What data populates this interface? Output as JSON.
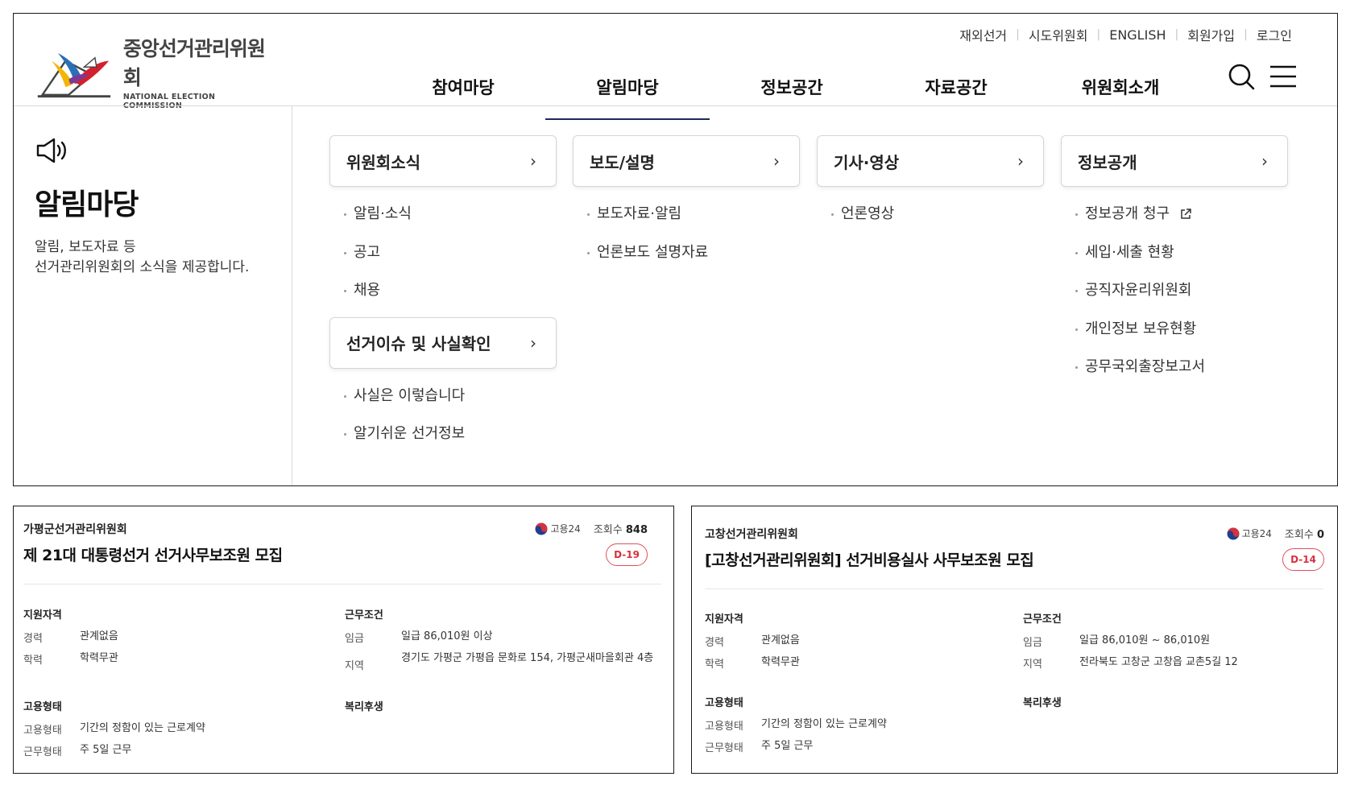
{
  "utility_nav": [
    "재외선거",
    "시도위원회",
    "ENGLISH",
    "회원가입",
    "로그인"
  ],
  "logo": {
    "name_ko": "중앙선거관리위원회",
    "name_en": "NATIONAL ELECTION COMMISSION"
  },
  "gnb": [
    "참여마당",
    "알림마당",
    "정보공간",
    "자료공간",
    "위원회소개"
  ],
  "gnb_active": "알림마당",
  "intro": {
    "title": "알림마당",
    "desc_line1": "알림, 보도자료 등",
    "desc_line2": "선거관리위원회의 소식을 제공합니다."
  },
  "categories": [
    {
      "label": "위원회소식",
      "items": [
        "알림·소식",
        "공고",
        "채용"
      ]
    },
    {
      "label": "선거이슈 및 사실확인",
      "items": [
        "사실은 이렇습니다",
        "알기쉬운 선거정보"
      ]
    },
    {
      "label": "보도/설명",
      "items": [
        "보도자료·알림",
        "언론보도 설명자료"
      ]
    },
    {
      "label": "기사·영상",
      "items": [
        "언론영상"
      ]
    },
    {
      "label": "정보공개",
      "items": [
        "정보공개 청구",
        "세입·세출 현황",
        "공직자윤리위원회",
        "개인정보 보유현황",
        "공무국외출장보고서"
      ]
    }
  ],
  "chevron": "›",
  "icons": {
    "search": "search-icon",
    "menu": "hamburger-menu-icon",
    "speaker": "speaker-icon",
    "external": "external-link-icon"
  },
  "colors": {
    "active_underline": "#1b2a5a",
    "dday": "#d6323e"
  },
  "jobs": [
    {
      "org": "가평군선거관리위원회",
      "source": "고용24",
      "views_label": "조회수",
      "views": "848",
      "title": "제 21대 대통령선거 선거사무보조원 모집",
      "dday": "D-19",
      "qual_head": "지원자격",
      "career_k": "경력",
      "career_v": "관계없음",
      "edu_k": "학력",
      "edu_v": "학력무관",
      "cond_head": "근무조건",
      "pay_k": "임금",
      "pay_v": "일급 86,010원 이상",
      "area_k": "지역",
      "area_v": "경기도 가평군 가평읍 문화로 154, 가평군새마을회관 4층",
      "emp_head": "고용형태",
      "emp_k": "고용형태",
      "emp_v": "기간의 정함이 있는 근로계약",
      "work_k": "근무형태",
      "work_v": "주 5일 근무",
      "welfare_head": "복리후생"
    },
    {
      "org": "고창선거관리위원회",
      "source": "고용24",
      "views_label": "조회수",
      "views": "0",
      "title": "[고창선거관리위원회] 선거비용실사 사무보조원 모집",
      "dday": "D-14",
      "qual_head": "지원자격",
      "career_k": "경력",
      "career_v": "관계없음",
      "edu_k": "학력",
      "edu_v": "학력무관",
      "cond_head": "근무조건",
      "pay_k": "임금",
      "pay_v": "일급 86,010원 ~ 86,010원",
      "area_k": "지역",
      "area_v": "전라북도 고창군 고창읍 교촌5길 12",
      "emp_head": "고용형태",
      "emp_k": "고용형태",
      "emp_v": "기간의 정함이 있는 근로계약",
      "work_k": "근무형태",
      "work_v": "주 5일 근무",
      "welfare_head": "복리후생"
    }
  ]
}
